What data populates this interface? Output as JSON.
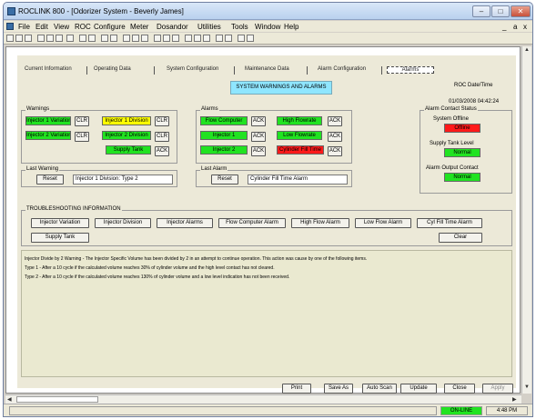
{
  "window": {
    "title": "ROCLINK 800 - [Odorizer System - Beverly James]",
    "minimize": "–",
    "maximize": "□",
    "close": "✕"
  },
  "menu": [
    "File",
    "Edit",
    "View",
    "ROC",
    "Configure",
    "Meter",
    "Dosandor",
    "Utilities",
    "Tools",
    "Window",
    "Help"
  ],
  "mdi_controls": [
    "_",
    "a",
    "x"
  ],
  "tabs": [
    "Current Information",
    "Operating Data",
    "System Configuration",
    "Maintenance Data",
    "Alarm Configuration",
    "Alarms"
  ],
  "banner": "SYSTEM WARNINGS AND ALARMS",
  "roc_datetime": {
    "label": "ROC Date/Time",
    "value": "01/03/2008 04:42:24"
  },
  "warnings": {
    "label": "Warnings",
    "items": [
      {
        "text": "Injector 1 Variation",
        "color": "#21e321",
        "btn": "CLR"
      },
      {
        "text": "Injector 1 Division",
        "color": "#ffff00",
        "btn": "CLR"
      },
      {
        "text": "Injector 2 Variation",
        "color": "#21e321",
        "btn": "CLR"
      },
      {
        "text": "Injector 2 Division",
        "color": "#21e321",
        "btn": "CLR"
      },
      {
        "text": "Supply Tank",
        "color": "#21e321",
        "btn": "ACK"
      }
    ]
  },
  "alarms": {
    "label": "Alarms",
    "items": [
      {
        "text": "Flow Computer",
        "color": "#21e321",
        "btn": "ACK"
      },
      {
        "text": "High Flowrate",
        "color": "#21e321",
        "btn": "ACK"
      },
      {
        "text": "Injector 1",
        "color": "#21e321",
        "btn": "ACK"
      },
      {
        "text": "Low Flowrate",
        "color": "#21e321",
        "btn": "ACK"
      },
      {
        "text": "Injector 2",
        "color": "#21e321",
        "btn": "ACK"
      },
      {
        "text": "Cylinder Fill Time",
        "color": "#ff1a1a",
        "btn": "ACK"
      }
    ]
  },
  "last_warning": {
    "label": "Last Warning",
    "reset": "Reset",
    "value": "Injector 1 Division: Type 2"
  },
  "last_alarm": {
    "label": "Last Alarm",
    "reset": "Reset",
    "value": "Cylinder Fill Time Alarm"
  },
  "alarm_contact": {
    "label": "Alarm Contact Status",
    "items": [
      {
        "label": "System Offline",
        "value": "Offline",
        "color": "#ff1a1a"
      },
      {
        "label": "Supply Tank Level",
        "value": "Normal",
        "color": "#21e321"
      },
      {
        "label": "Alarm Output Contact",
        "value": "Normal",
        "color": "#21e321"
      }
    ]
  },
  "troubleshooting": {
    "label": "TROUBLESHOOTING INFORMATION",
    "buttons": [
      "Injector Variation",
      "Injector Division",
      "Injector Alarms",
      "Flow Computer Alarm",
      "High Flow Alarm",
      "Low Flow Alarm",
      "Cyl Fill Time Alarm"
    ],
    "supply_tank": "Supply Tank",
    "clear": "Clear",
    "text": [
      "Injector Divide by 2 Warning - The Injector Specific Volume has been divided by 2 in an attempt to continue operation.  This action was cause by one of the following items.",
      "Type 1 - After a 10 cycle if the calculated volume reaches 30% of cylinder volume and the high level contact has not cleared.",
      "Type 2 - After a 10 cycle if the calculated volume reaches 130% of cylinder volume and a low level indication has not been received."
    ]
  },
  "bottom_buttons": [
    "Print",
    "Save As",
    "Auto Scan",
    "Update",
    "Close",
    "Apply"
  ],
  "status": {
    "online": "ON-LINE",
    "time": "4:48 PM"
  }
}
